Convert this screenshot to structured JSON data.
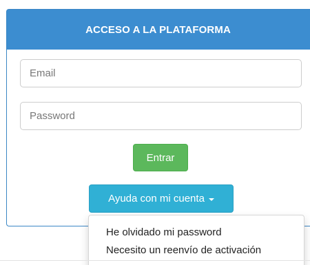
{
  "panel": {
    "heading": "ACCESO A LA PLATAFORMA"
  },
  "form": {
    "email_placeholder": "Email",
    "password_placeholder": "Password",
    "submit_label": "Entrar"
  },
  "help": {
    "button_label": "Ayuda con mi cuenta",
    "menu_items": [
      "He olvidado mi password",
      "Necesito un reenvío de activación"
    ]
  },
  "colors": {
    "heading_bg": "#3c8dd0",
    "submit_bg": "#5cb85c",
    "help_bg": "#30b0d5"
  },
  "icons": {
    "help_caret": "caret-down-icon"
  }
}
